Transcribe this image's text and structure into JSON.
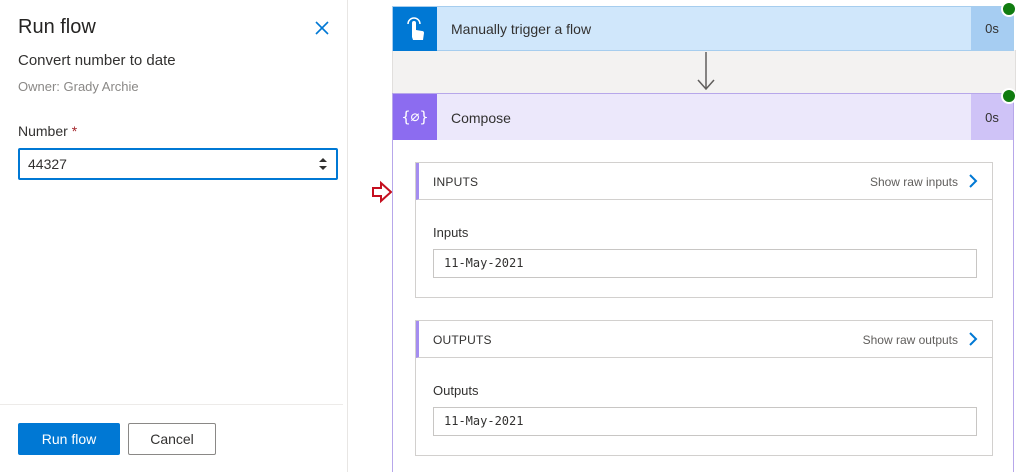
{
  "panel": {
    "title": "Run flow",
    "flow_name": "Convert number to date",
    "owner": "Owner: Grady Archie",
    "field_label": "Number",
    "required_marker": "*",
    "field_value": "44327",
    "run_button": "Run flow",
    "cancel_button": "Cancel",
    "close_icon": "close-icon"
  },
  "trigger": {
    "title": "Manually trigger a flow",
    "duration": "0s",
    "icon": "touch-icon",
    "status": "succeeded"
  },
  "compose": {
    "title": "Compose",
    "icon_glyph": "{∅}",
    "duration": "0s",
    "status": "succeeded",
    "inputs": {
      "header": "INPUTS",
      "show_raw": "Show raw inputs",
      "field_label": "Inputs",
      "value": "11-May-2021"
    },
    "outputs": {
      "header": "OUTPUTS",
      "show_raw": "Show raw outputs",
      "field_label": "Outputs",
      "value": "11-May-2021"
    }
  },
  "colors": {
    "primary": "#0078d4",
    "trigger_bg": "#d0e7fb",
    "compose_accent": "#8c6cf0",
    "success": "#107c10",
    "annotation_arrow": "#c50f1f"
  }
}
